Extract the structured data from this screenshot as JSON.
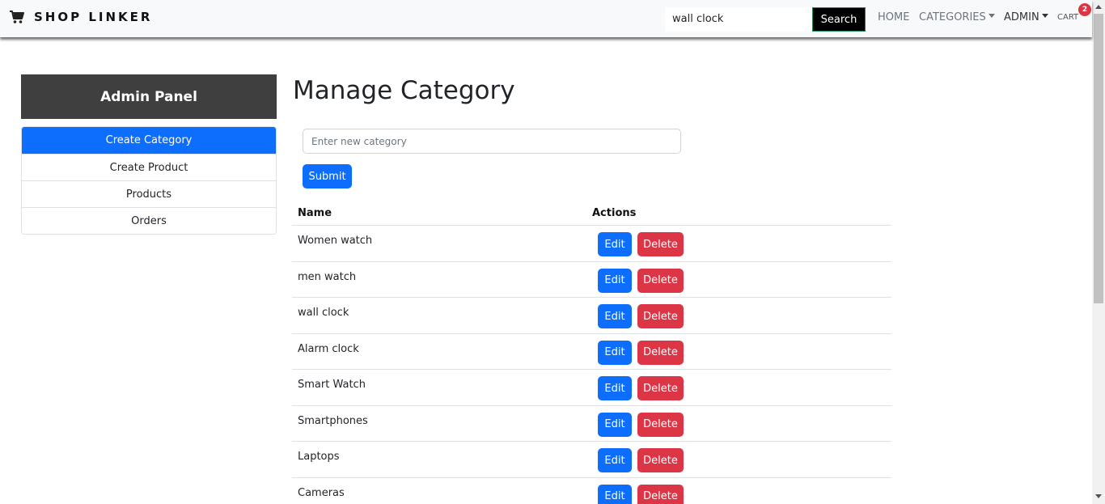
{
  "navbar": {
    "brand": "SHOP LINKER",
    "brand_icon": "shopping-cart-icon",
    "search_value": "wall clock",
    "search_button": "Search",
    "links": {
      "home": "HOME",
      "categories": "CATEGORIES",
      "admin": "ADMIN",
      "cart": "CART"
    },
    "cart_count": "2"
  },
  "sidebar": {
    "title": "Admin Panel",
    "items": [
      {
        "label": "Create Category",
        "active": true
      },
      {
        "label": "Create Product",
        "active": false
      },
      {
        "label": "Products",
        "active": false
      },
      {
        "label": "Orders",
        "active": false
      }
    ]
  },
  "main": {
    "title": "Manage Category",
    "input_placeholder": "Enter new category",
    "submit_label": "Submit",
    "table": {
      "headers": {
        "name": "Name",
        "actions": "Actions"
      },
      "edit_label": "Edit",
      "delete_label": "Delete",
      "rows": [
        {
          "name": "Women watch"
        },
        {
          "name": "men watch"
        },
        {
          "name": "wall clock"
        },
        {
          "name": "Alarm clock"
        },
        {
          "name": "Smart Watch"
        },
        {
          "name": "Smartphones"
        },
        {
          "name": "Laptops"
        },
        {
          "name": "Cameras"
        }
      ]
    }
  },
  "colors": {
    "primary": "#0d6efd",
    "danger": "#dc3545",
    "admin_header_bg": "#3f3f3f",
    "navbar_bg": "#f8f9fa"
  }
}
